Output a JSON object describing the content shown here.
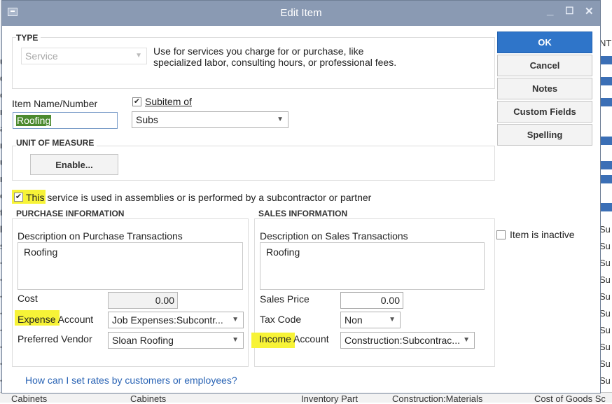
{
  "window": {
    "title": "Edit Item"
  },
  "type_section": {
    "heading": "TYPE",
    "selected": "Service",
    "description": "Use for services you charge for or purchase, like specialized labor, consulting hours, or professional fees."
  },
  "item": {
    "name_label": "Item Name/Number",
    "name_value": "Roofing",
    "subitem_label": "Subitem of",
    "subitem_checked": true,
    "subitem_value": "Subs"
  },
  "unit_of_measure": {
    "heading": "UNIT OF MEASURE",
    "enable_label": "Enable..."
  },
  "assembly": {
    "checked": true,
    "text_highlight": "This",
    "text_rest": " service is used in assemblies or is performed by a subcontractor or partner"
  },
  "purchase": {
    "heading": "PURCHASE INFORMATION",
    "desc_label": "Description on Purchase Transactions",
    "desc_value": "Roofing",
    "cost_label": "Cost",
    "cost_value": "0.00",
    "expense_label_hl": "Expense",
    "expense_label_rest": " Account",
    "expense_value": "Job Expenses:Subcontr...",
    "vendor_label": "Preferred Vendor",
    "vendor_value": "Sloan Roofing"
  },
  "sales": {
    "heading": "SALES INFORMATION",
    "desc_label": "Description on Sales Transactions",
    "desc_value": "Roofing",
    "price_label": "Sales Price",
    "price_value": "0.00",
    "tax_label": "Tax Code",
    "tax_value": "Non",
    "income_label_hl": "Income",
    "income_label_rest": " Account",
    "income_value": "Construction:Subcontrac..."
  },
  "buttons": {
    "ok": "OK",
    "cancel": "Cancel",
    "notes": "Notes",
    "custom_fields": "Custom Fields",
    "spelling": "Spelling"
  },
  "inactive_label": "Item is inactive",
  "help_link": "How can I set rates by customers or employees?",
  "background": {
    "bottom_row": [
      "Cabinets",
      "Cabinets",
      "Inventory Part",
      "Construction:Materials",
      "Cost of Goods Sc"
    ],
    "right_col_header": "NT",
    "right_col_cells": [
      "Su",
      "Su",
      "Su",
      "Su",
      "Su",
      "Su",
      "Su",
      "Su",
      "Su",
      "Su"
    ],
    "left_col_cells": [
      "u",
      "d",
      "c",
      "r",
      "a",
      "r",
      "u",
      "n",
      "e",
      "t",
      "l",
      "s",
      "<",
      "<",
      "<",
      "<",
      "<",
      "<",
      "<",
      "<"
    ]
  },
  "colors": {
    "accent": "#2f75c9",
    "titlebar": "#8a9ab3",
    "highlight": "#f7f337"
  }
}
